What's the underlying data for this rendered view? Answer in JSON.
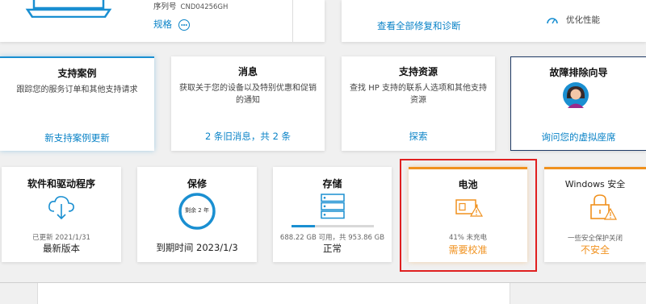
{
  "top": {
    "serial_label": "序列号",
    "serial_value": "CND04256GH",
    "specs_link": "规格",
    "view_all_link": "查看全部修复和诊断",
    "optimize_label": "优化性能"
  },
  "support_cards": [
    {
      "title": "支持案例",
      "desc": "跟踪您的服务订单和其他支持请求",
      "link": "新支持案例更新"
    },
    {
      "title": "消息",
      "desc": "获取关于您的设备以及特别优惠和促销的通知",
      "link": "2 条旧消息，共 2 条"
    },
    {
      "title": "支持资源",
      "desc": "查找 HP 支持的联系人选项和其他支持资源",
      "link": "探索"
    },
    {
      "title": "故障排除向导",
      "link": "询问您的虚拟座席"
    }
  ],
  "status_cards": {
    "drivers": {
      "title": "软件和驱动程序",
      "sub": "已更新 2021/1/31",
      "value": "最新版本"
    },
    "warranty": {
      "title": "保修",
      "ring_label": "剩余 2 年",
      "value": "到期时间 2023/1/3"
    },
    "storage": {
      "title": "存储",
      "sub": "688.22 GB 可用，共 953.86 GB",
      "value": "正常",
      "used_fraction": 0.28
    },
    "battery": {
      "title": "电池",
      "sub": "41% 未充电",
      "value": "需要校准"
    },
    "security": {
      "title": "Windows 安全",
      "sub": "一些安全保护关闭",
      "value": "不安全"
    }
  },
  "colors": {
    "link": "#0a83c7",
    "warning": "#f0911e",
    "highlight_border": "#e02020",
    "accent_blue": "#1a8fd1"
  }
}
